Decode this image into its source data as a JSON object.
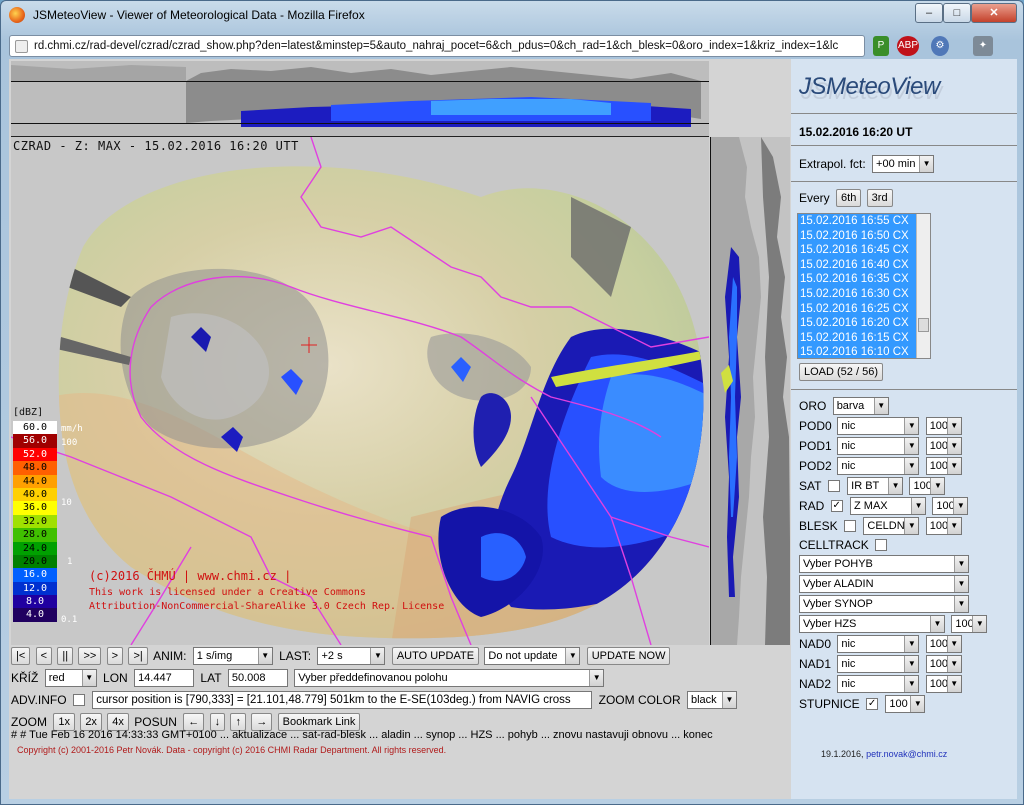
{
  "window": {
    "title": "JSMeteoView - Viewer of Meteorological Data - Mozilla Firefox",
    "min": "–",
    "max": "□",
    "close": "✕"
  },
  "browser": {
    "url": "rd.chmi.cz/rad-devel/czrad/czrad_show.php?den=latest&minstep=5&auto_nahraj_pocet=6&ch_pdus=0&ch_rad=1&ch_blesk=0&oro_index=1&kriz_index=1&lc",
    "addons": [
      "P",
      "ABP",
      "⚙",
      "✦"
    ]
  },
  "map": {
    "label": "CZRAD - Z: MAX - 15.02.2016 16:20 UTT",
    "copyright": "(c)2016 ČHMÚ | www.chmi.cz |",
    "license1": "This work is licensed under a Creative Commons",
    "license2": "Attribution-NonCommercial-ShareAlike 3.0 Czech Rep. License",
    "legend": {
      "title": "[dBZ]",
      "levels": [
        {
          "v": "60.0",
          "c": "#ffffff",
          "t": "#000"
        },
        {
          "v": "56.0",
          "c": "#a00000",
          "t": "#fff"
        },
        {
          "v": "52.0",
          "c": "#ff0000",
          "t": "#fff"
        },
        {
          "v": "48.0",
          "c": "#ff6000",
          "t": "#000"
        },
        {
          "v": "44.0",
          "c": "#ffa000",
          "t": "#000"
        },
        {
          "v": "40.0",
          "c": "#ffd000",
          "t": "#000"
        },
        {
          "v": "36.0",
          "c": "#ffff00",
          "t": "#000"
        },
        {
          "v": "32.0",
          "c": "#a0e000",
          "t": "#000"
        },
        {
          "v": "28.0",
          "c": "#40c000",
          "t": "#000"
        },
        {
          "v": "24.0",
          "c": "#00a000",
          "t": "#000"
        },
        {
          "v": "20.0",
          "c": "#008000",
          "t": "#000"
        },
        {
          "v": "16.0",
          "c": "#0060ff",
          "t": "#fff"
        },
        {
          "v": "12.0",
          "c": "#0030d0",
          "t": "#fff"
        },
        {
          "v": "8.0",
          "c": "#2000a0",
          "t": "#fff"
        },
        {
          "v": "4.0",
          "c": "#200060",
          "t": "#fff"
        }
      ],
      "mm_labels": [
        "mm/h",
        "100",
        "10",
        "1",
        "0.1"
      ]
    }
  },
  "controls": {
    "nav_buttons": [
      "|<",
      "<",
      "||",
      ">>",
      ">",
      ">|"
    ],
    "anim_label": "ANIM:",
    "anim_value": "1 s/img",
    "last_label": "LAST:",
    "last_value": "+2 s",
    "auto_update_label": "AUTO UPDATE",
    "auto_update_value": "Do not update",
    "update_now": "UPDATE NOW",
    "kriz_label": "KŘÍŽ",
    "kriz_value": "red",
    "lon_label": "LON",
    "lon_value": "14.447",
    "lat_label": "LAT",
    "lat_value": "50.008",
    "position_value": "Vyber předdefinovanou polohu",
    "adv_info_label": "ADV.INFO",
    "cursor_info": "cursor position is [790,333] = [21.101,48.779]  501km to the E-SE(103deg.) from NAVIG cross",
    "zoom_color_label": "ZOOM COLOR",
    "zoom_color_value": "black",
    "zoom_label": "ZOOM",
    "zoom_buttons": [
      "1x",
      "2x",
      "4x"
    ],
    "posun_label": "POSUN",
    "arrows": [
      "←",
      "↓",
      "↑",
      "→"
    ],
    "bookmark": "Bookmark Link"
  },
  "status": "# # Tue Feb 16 2016 14:33:33 GMT+0100 ... aktualizace ... sat-rad-blesk ... aladin ... synop ... HZS ... pohyb ... znovu nastavuji obnovu ... konec",
  "copyright": "Copyright (c) 2001-2016 Petr Novák. Data - copyright (c) 2016 CHMI Radar Department. All rights reserved.",
  "side": {
    "logo": "JSMeteoView",
    "current_time": "15.02.2016 16:20 UT",
    "extrapol_label": "Extrapol. fct:",
    "extrapol_value": "+00 min",
    "every_label": "Every",
    "every_buttons": [
      "6th",
      "3rd"
    ],
    "times": [
      "15.02.2016 16:55 CX",
      "15.02.2016 16:50 CX",
      "15.02.2016 16:45 CX",
      "15.02.2016 16:40 CX",
      "15.02.2016 16:35 CX",
      "15.02.2016 16:30 CX",
      "15.02.2016 16:25 CX",
      "15.02.2016 16:20 CX",
      "15.02.2016 16:15 CX",
      "15.02.2016 16:10 CX"
    ],
    "load": "LOAD (52 / 56)",
    "oro_label": "ORO",
    "oro_value": "barva",
    "pod": [
      {
        "label": "POD0",
        "value": "nic",
        "pct": "100"
      },
      {
        "label": "POD1",
        "value": "nic",
        "pct": "100"
      },
      {
        "label": "POD2",
        "value": "nic",
        "pct": "100"
      }
    ],
    "sat_label": "SAT",
    "sat_value": "IR BT",
    "sat_pct": "100",
    "rad_label": "RAD",
    "rad_value": "Z MAX",
    "rad_pct": "100",
    "blesk_label": "BLESK",
    "blesk_value": "CELDN",
    "blesk_pct": "100",
    "celltrack_label": "CELLTRACK",
    "pohyb": "Vyber POHYB",
    "aladin": "Vyber ALADIN",
    "synop": "Vyber SYNOP",
    "hzs": "Vyber HZS",
    "hzs_pct": "100",
    "nad": [
      {
        "label": "NAD0",
        "value": "nic",
        "pct": "100"
      },
      {
        "label": "NAD1",
        "value": "nic",
        "pct": "100"
      },
      {
        "label": "NAD2",
        "value": "nic",
        "pct": "100"
      }
    ],
    "stupnice_label": "STUPNICE",
    "stupnice_pct": "100",
    "footer_date": "19.1.2016,",
    "footer_email": "petr.novak@chmi.cz"
  }
}
